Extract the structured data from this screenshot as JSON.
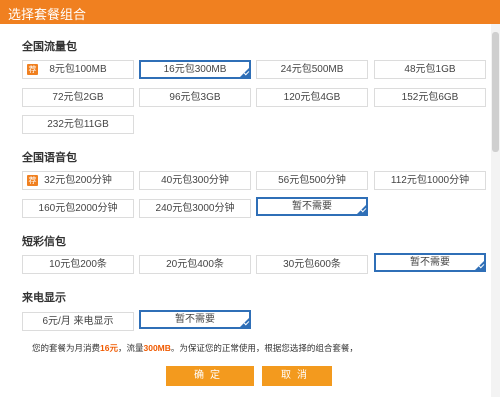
{
  "window": {
    "title": "选择套餐组合"
  },
  "sections": {
    "data": {
      "title": "全国流量包",
      "badge": "荐",
      "options": [
        "8元包100MB",
        "16元包300MB",
        "24元包500MB",
        "48元包1GB",
        "72元包2GB",
        "96元包3GB",
        "120元包4GB",
        "152元包6GB",
        "232元包11GB"
      ],
      "selected": "16元包300MB"
    },
    "voice": {
      "title": "全国语音包",
      "badge": "荐",
      "options": [
        "32元包200分钟",
        "40元包300分钟",
        "56元包500分钟",
        "112元包1000分钟",
        "160元包2000分钟",
        "240元包3000分钟",
        "暂不需要"
      ],
      "selected": "暂不需要"
    },
    "sms": {
      "title": "短彩信包",
      "options": [
        "10元包200条",
        "20元包400条",
        "30元包600条",
        "暂不需要"
      ],
      "selected": "暂不需要"
    },
    "caller": {
      "title": "来电显示",
      "options": [
        "6元/月 来电显示",
        "暂不需要"
      ],
      "selected": "暂不需要"
    }
  },
  "summary": {
    "prefix": "您的套餐为月消费",
    "amount": "16元",
    "mid": "，流量",
    "data": "300MB",
    "suffix": "。为保证您的正常使用，根据您选择的组合套餐，"
  },
  "buttons": {
    "confirm": "确定",
    "cancel": "取消"
  },
  "colors": {
    "accent": "#f08020",
    "selection": "#2f6fb7",
    "highlight": "#f05a00"
  }
}
